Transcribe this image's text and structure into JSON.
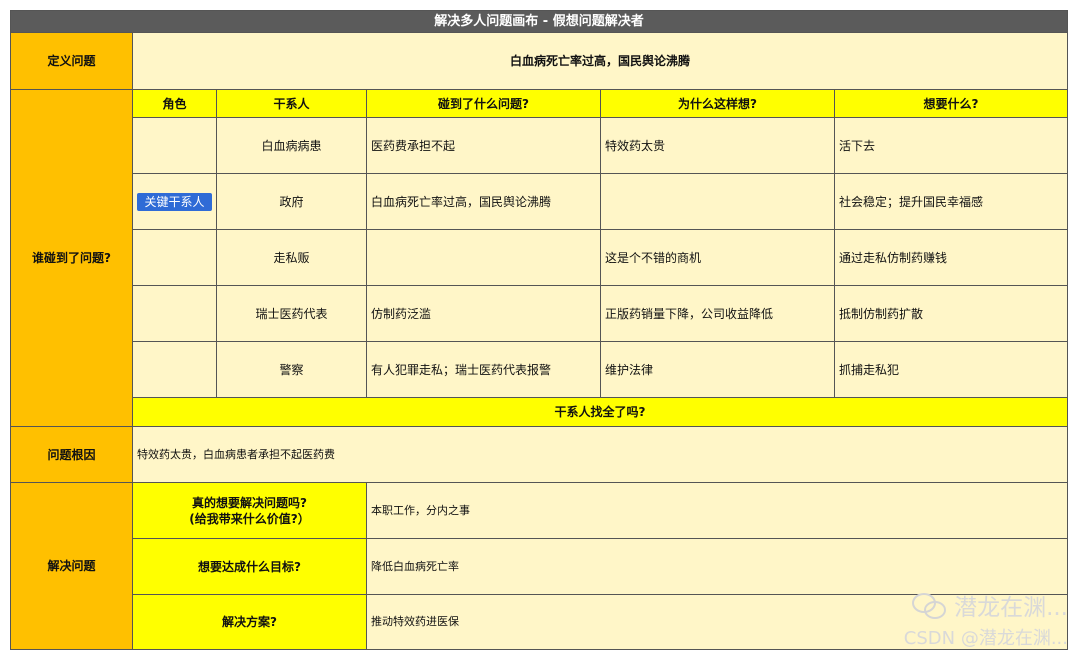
{
  "title": "解决多人问题画布 - 假想问题解决者",
  "define": {
    "label": "定义问题",
    "text": "白血病死亡率过高，国民舆论沸腾"
  },
  "who": {
    "label": "谁碰到了问题?",
    "headers": [
      "角色",
      "干系人",
      "碰到了什么问题?",
      "为什么这样想?",
      "想要什么?"
    ],
    "rows": [
      {
        "role": "",
        "stakeholder": "白血病病患",
        "problem": "医药费承担不起",
        "why": "特效药太贵",
        "want": "活下去"
      },
      {
        "role": "关键干系人",
        "stakeholder": "政府",
        "problem": "白血病死亡率过高，国民舆论沸腾",
        "why": "",
        "want": "社会稳定；提升国民幸福感"
      },
      {
        "role": "",
        "stakeholder": "走私贩",
        "problem": "",
        "why": "这是个不错的商机",
        "want": "通过走私仿制药赚钱"
      },
      {
        "role": "",
        "stakeholder": "瑞士医药代表",
        "problem": "仿制药泛滥",
        "why": "正版药销量下降，公司收益降低",
        "want": "抵制仿制药扩散"
      },
      {
        "role": "",
        "stakeholder": "警察",
        "problem": "有人犯罪走私；瑞士医药代表报警",
        "why": "维护法律",
        "want": "抓捕走私犯"
      }
    ],
    "footer": "干系人找全了吗?"
  },
  "root": {
    "label": "问题根因",
    "text": "特效药太贵，白血病患者承担不起医药费"
  },
  "solve": {
    "label": "解决问题",
    "items": [
      {
        "q1": "真的想要解决问题吗?",
        "q2": "(给我带来什么价值?）",
        "a": "本职工作，分内之事"
      },
      {
        "q1": "想要达成什么目标?",
        "q2": "",
        "a": "降低白血病死亡率"
      },
      {
        "q1": "解决方案?",
        "q2": "",
        "a": "推动特效药进医保"
      }
    ]
  },
  "watermark": {
    "line1": "潜龙在渊...",
    "line2": "CSDN @潜龙在渊..."
  }
}
